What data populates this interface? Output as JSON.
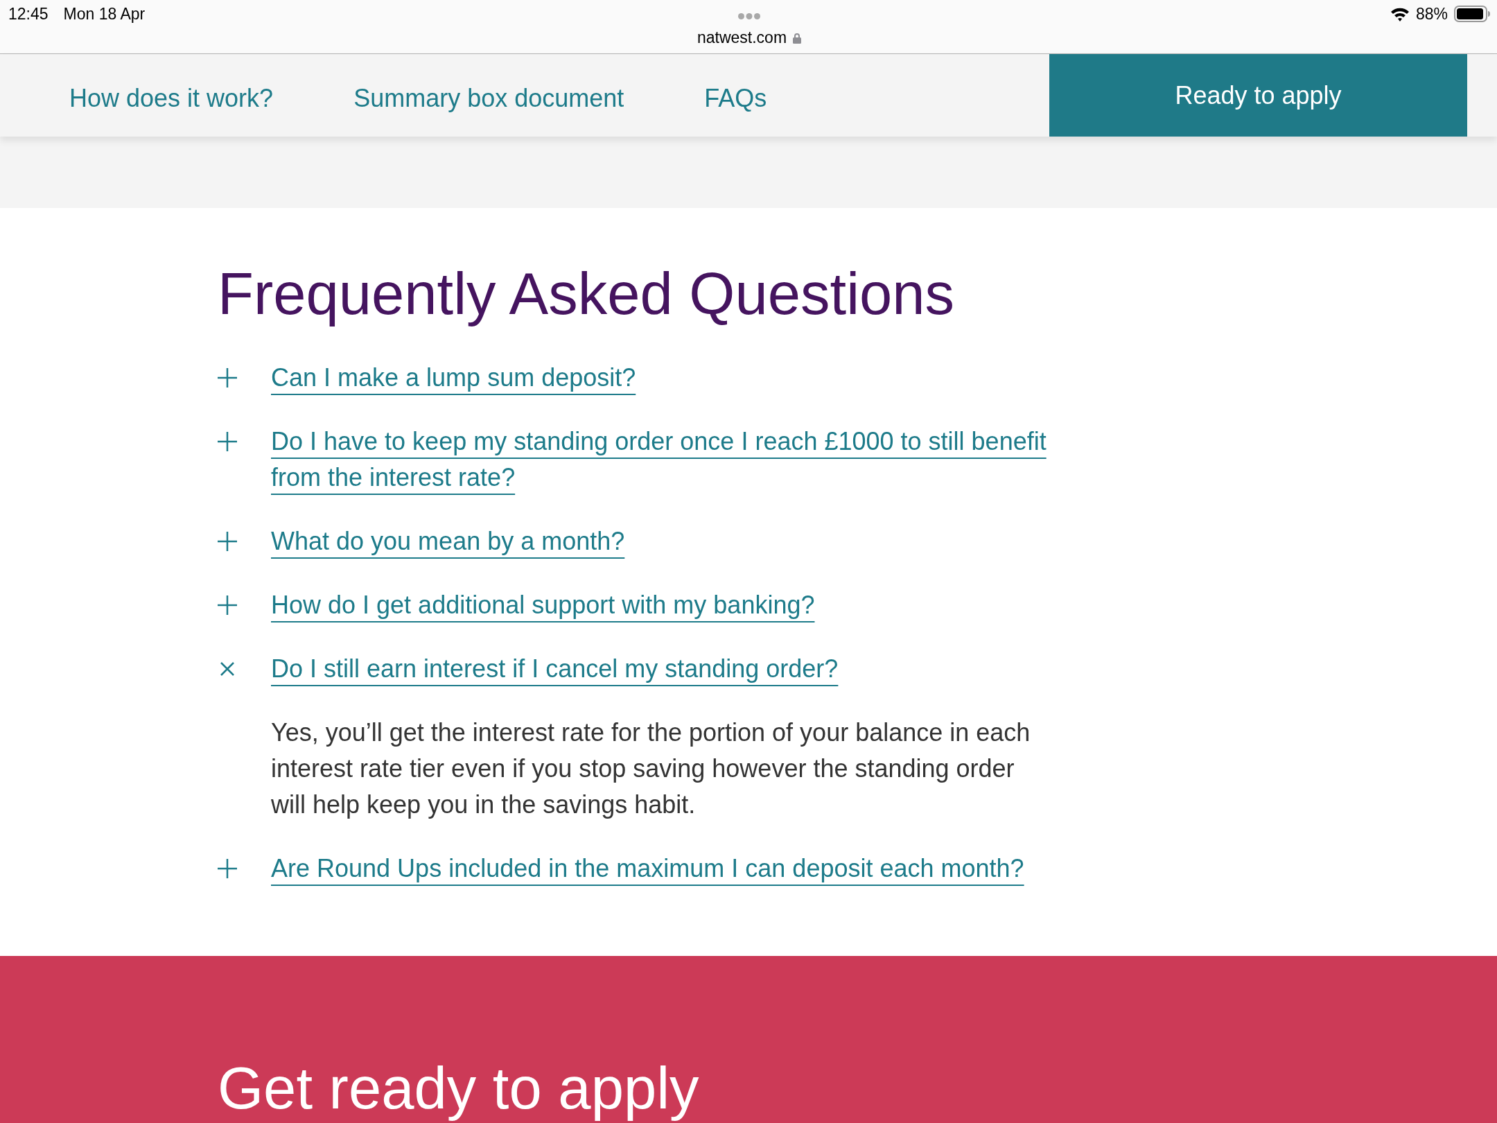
{
  "status_bar": {
    "time": "12:45",
    "date": "Mon 18 Apr",
    "battery": "88%"
  },
  "address_bar": {
    "url": "natwest.com"
  },
  "nav": {
    "links": [
      "How does it work?",
      "Summary box document",
      "FAQs"
    ],
    "cta": "Ready to apply"
  },
  "faq": {
    "title": "Frequently Asked Questions",
    "items": [
      {
        "question": "Can I make a lump sum deposit?",
        "expanded": false
      },
      {
        "question": "Do I have to keep my standing order once I reach £1000 to still benefit from the interest rate?",
        "expanded": false
      },
      {
        "question": "What do you mean by a month?",
        "expanded": false
      },
      {
        "question": "How do I get additional support with my banking?",
        "expanded": false
      },
      {
        "question": "Do I still earn interest if I cancel my standing order?",
        "expanded": true,
        "answer": "Yes, you’ll get the interest rate for the portion of your balance in each interest rate tier even if you stop saving however the standing order will help keep you in the savings habit."
      },
      {
        "question": "Are Round Ups included in the maximum I can deposit each month?",
        "expanded": false
      }
    ]
  },
  "apply_section": {
    "title": "Get ready to apply"
  }
}
